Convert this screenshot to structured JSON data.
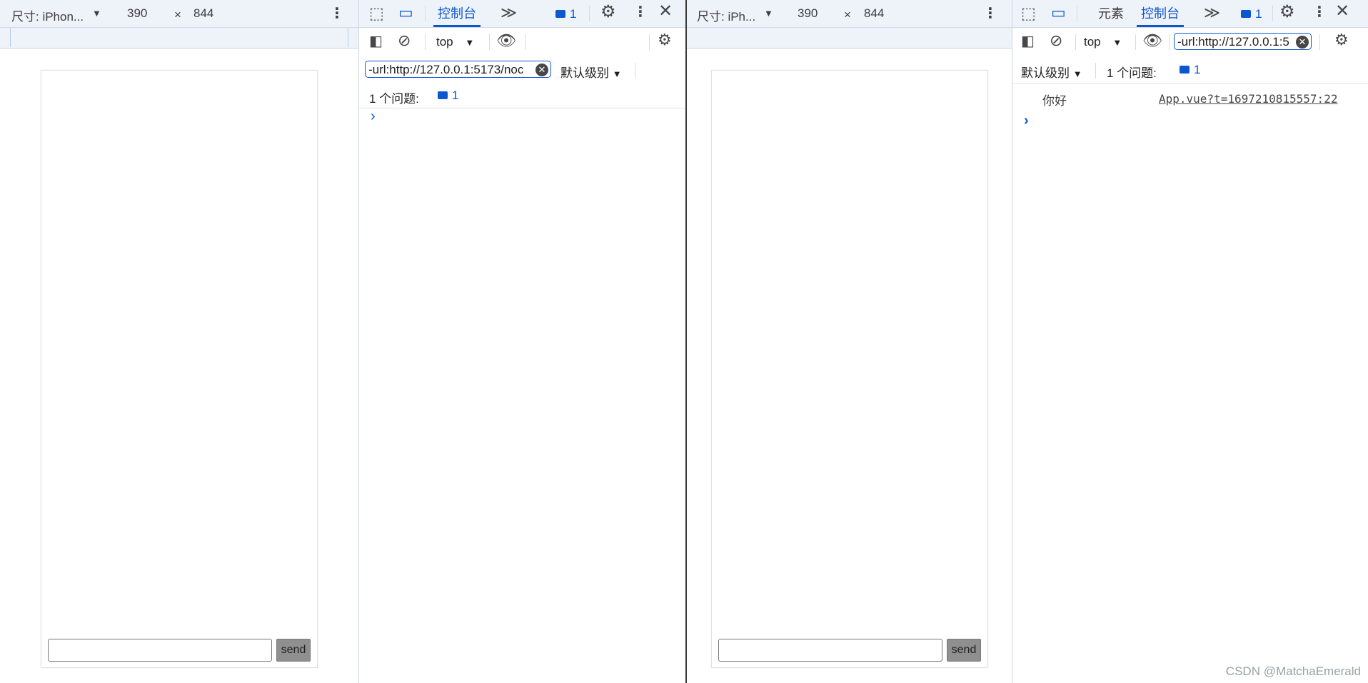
{
  "left": {
    "device_bar": {
      "size_label": "尺寸: iPhon...",
      "width": "390",
      "times": "×",
      "height": "844"
    },
    "chat": {
      "input_value": "",
      "send_label": "send"
    },
    "devtools": {
      "tabs": [
        {
          "label": "控制台",
          "active": true
        }
      ],
      "more_tabs": "≫",
      "message_count": "1",
      "context": "top",
      "filter_value": "-url:http://127.0.0.1:5173/noc",
      "level": "默认级别",
      "issues_label": "1 个问题:",
      "issues_count": "1"
    }
  },
  "right": {
    "device_bar": {
      "size_label": "尺寸: iPh...",
      "width": "390",
      "times": "×",
      "height": "844"
    },
    "chat": {
      "input_value": "",
      "send_label": "send"
    },
    "devtools": {
      "tabs": [
        {
          "label": "元素",
          "active": false
        },
        {
          "label": "控制台",
          "active": true
        }
      ],
      "more_tabs": "≫",
      "message_count": "1",
      "context": "top",
      "filter_value": "-url:http://127.0.0.1:5",
      "level": "默认级别",
      "issues_label": "1 个问题:",
      "issues_count": "1",
      "console": [
        {
          "message": "你好",
          "source": "App.vue?t=1697210815557:22"
        }
      ]
    }
  },
  "watermark": "CSDN @MatchaEmerald",
  "colors": {
    "accent": "#0b57d0",
    "toolbar_bg": "#eef2f9",
    "send_button": "#8f8f8f"
  }
}
